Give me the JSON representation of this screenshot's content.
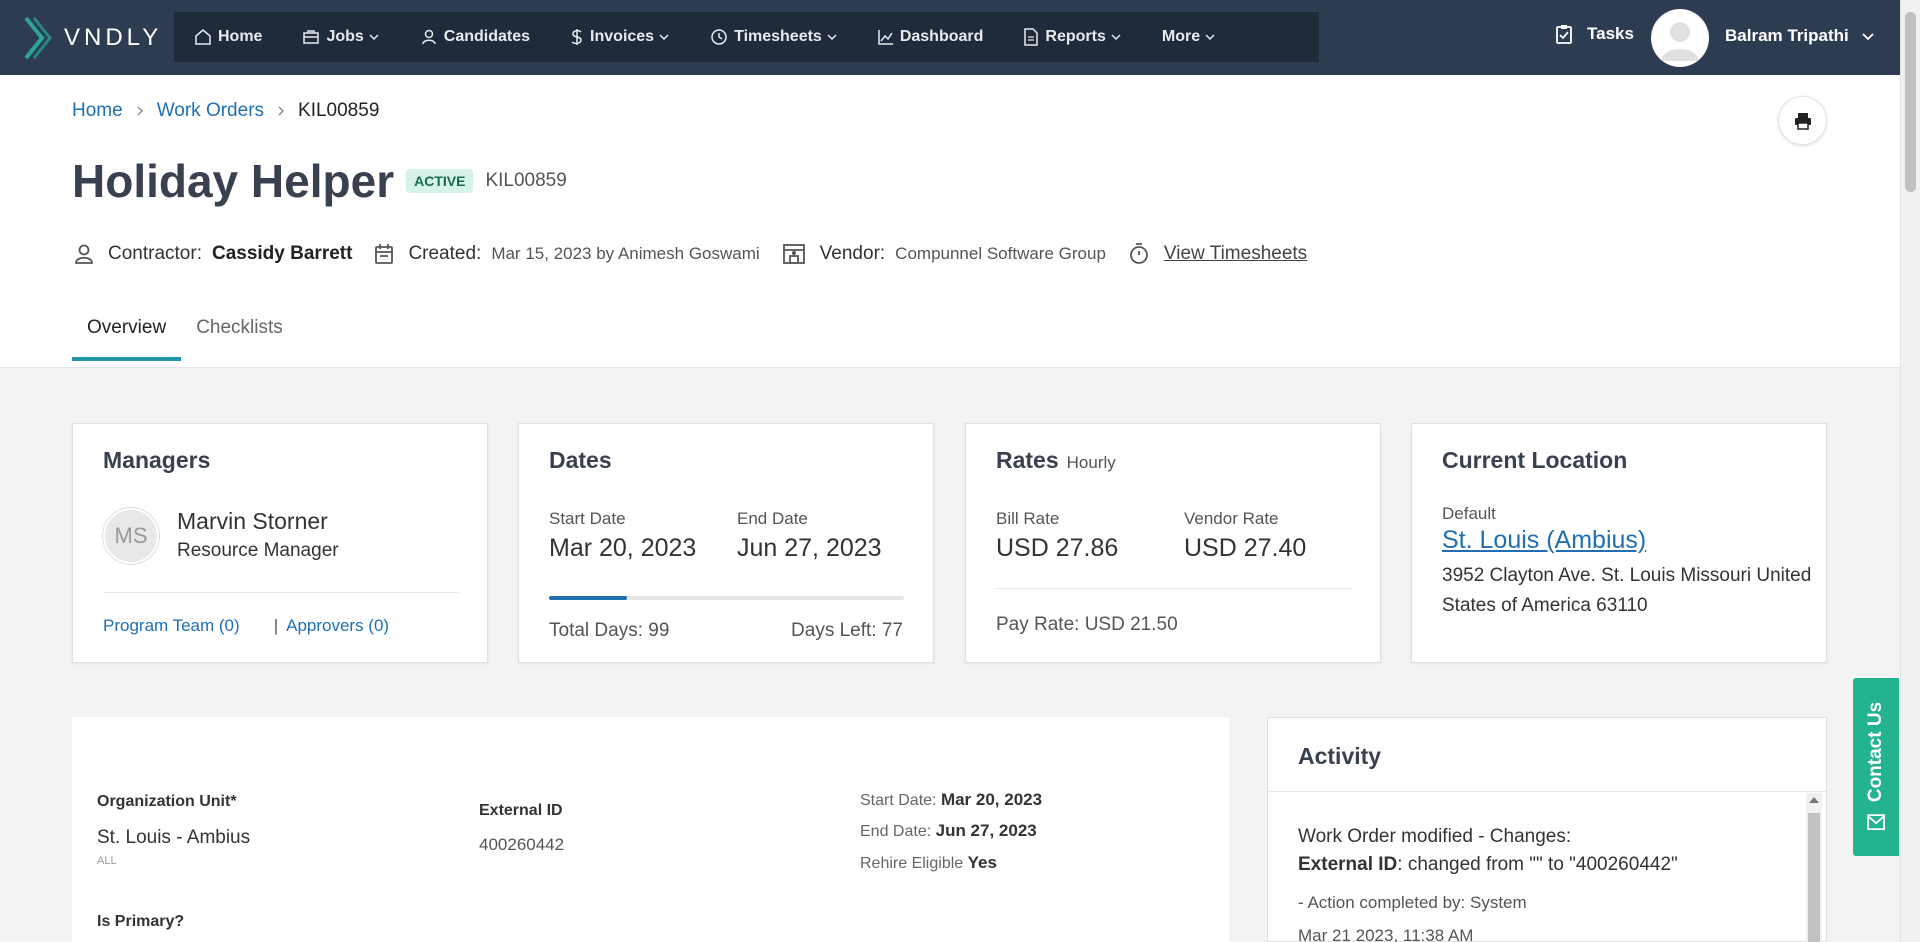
{
  "app": {
    "logo_text": "VNDLY"
  },
  "nav": {
    "items": [
      {
        "label": "Home",
        "icon": "home-icon",
        "dropdown": false
      },
      {
        "label": "Jobs",
        "icon": "briefcase-icon",
        "dropdown": true
      },
      {
        "label": "Candidates",
        "icon": "person-icon",
        "dropdown": false
      },
      {
        "label": "Invoices",
        "icon": "dollar-icon",
        "dropdown": true
      },
      {
        "label": "Timesheets",
        "icon": "clock-icon",
        "dropdown": true
      },
      {
        "label": "Dashboard",
        "icon": "chart-icon",
        "dropdown": false
      },
      {
        "label": "Reports",
        "icon": "document-icon",
        "dropdown": true
      },
      {
        "label": "More",
        "icon": "",
        "dropdown": true
      }
    ],
    "tasks_label": "Tasks",
    "user_name": "Balram Tripathi"
  },
  "breadcrumb": {
    "home": "Home",
    "work_orders": "Work Orders",
    "current": "KIL00859"
  },
  "header": {
    "title": "Holiday Helper",
    "status": "ACTIVE",
    "id": "KIL00859",
    "contractor_label": "Contractor:",
    "contractor_name": "Cassidy Barrett",
    "created_label": "Created:",
    "created_value": "Mar 15, 2023 by Animesh Goswami",
    "vendor_label": "Vendor:",
    "vendor_value": "Compunnel Software Group",
    "view_timesheets": "View Timesheets"
  },
  "tabs": [
    {
      "label": "Overview",
      "active": true
    },
    {
      "label": "Checklists",
      "active": false
    }
  ],
  "managers": {
    "title": "Managers",
    "initials": "MS",
    "name": "Marvin Storner",
    "role": "Resource Manager",
    "program_team": "Program Team (0)",
    "approvers": "Approvers (0)"
  },
  "dates": {
    "title": "Dates",
    "start_label": "Start Date",
    "start_value": "Mar 20, 2023",
    "end_label": "End Date",
    "end_value": "Jun 27, 2023",
    "progress_fraction": 0.22,
    "total_days": "Total Days: 99",
    "days_left": "Days Left: 77"
  },
  "rates": {
    "title": "Rates",
    "subtitle": "Hourly",
    "bill_label": "Bill Rate",
    "bill_value": "USD 27.86",
    "vendor_label": "Vendor Rate",
    "vendor_value": "USD 27.40",
    "pay_rate": "Pay Rate: USD 21.50"
  },
  "location": {
    "title": "Current Location",
    "default_label": "Default",
    "name": "St. Louis (Ambius)",
    "address": "3952 Clayton Ave. St. Louis Missouri United States of America 63110"
  },
  "details": {
    "org_unit_label": "Organization Unit*",
    "org_unit_value": "St. Louis - Ambius",
    "org_unit_sub": "ALL",
    "external_id_label": "External ID",
    "external_id_value": "400260442",
    "start_label": "Start Date:",
    "start_value": "Mar 20, 2023",
    "end_label": "End Date:",
    "end_value": "Jun 27, 2023",
    "rehire_label": "Rehire Eligible",
    "rehire_value": "Yes",
    "is_primary_label": "Is Primary?"
  },
  "activity": {
    "title": "Activity",
    "line1": "Work Order modified - Changes:",
    "line2_label": "External ID",
    "line2_rest": ": changed from \"\" to \"400260442\"",
    "line3": "- Action completed by: System",
    "line4": "Mar 21 2023, 11:38 AM"
  },
  "contact_us": "Contact Us",
  "colors": {
    "nav_bg": "#2e3c52",
    "nav_group_bg": "#1f2a3a",
    "link": "#1f6fb2",
    "accent": "#2196a6",
    "contact_bg": "#24b38f",
    "badge_bg": "#d6f3ea"
  }
}
